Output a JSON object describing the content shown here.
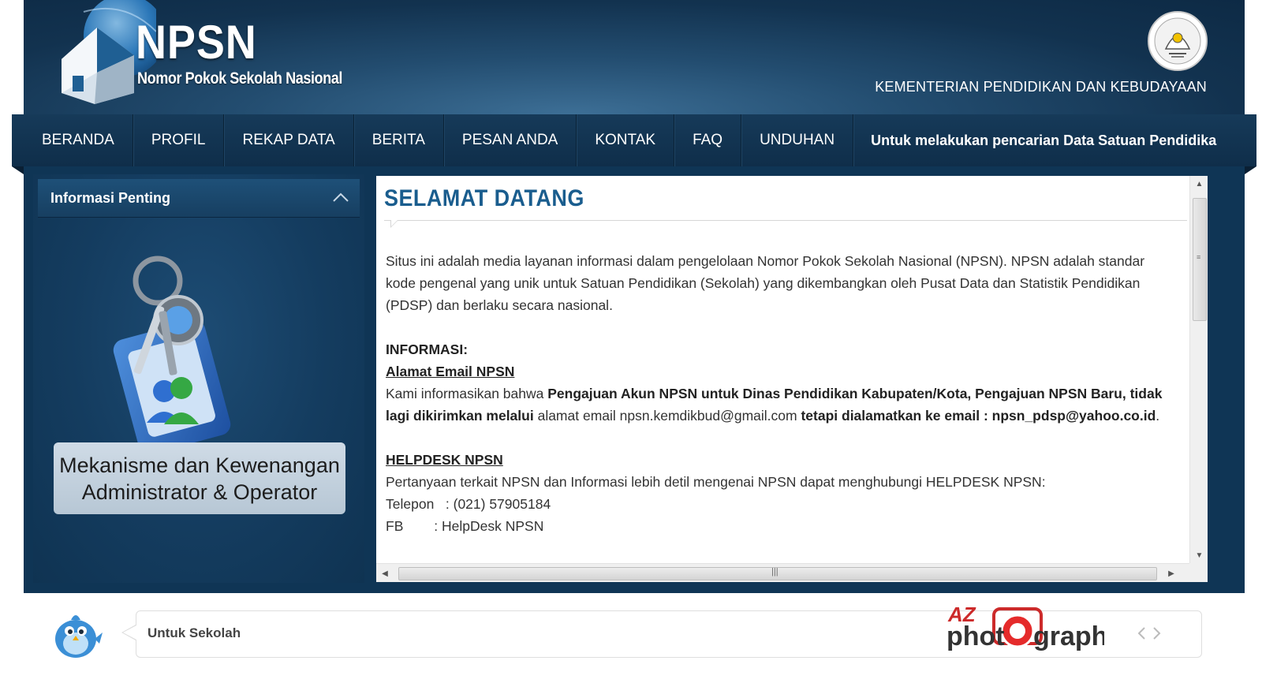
{
  "header": {
    "logo_title": "NPSN",
    "logo_subtitle": "Nomor Pokok Sekolah Nasional",
    "ministry": "KEMENTERIAN PENDIDIKAN DAN KEBUDAYAAN"
  },
  "nav": {
    "items": [
      {
        "label": "BERANDA"
      },
      {
        "label": "PROFIL"
      },
      {
        "label": "REKAP DATA"
      },
      {
        "label": "BERITA"
      },
      {
        "label": "PESAN ANDA"
      },
      {
        "label": "KONTAK"
      },
      {
        "label": "FAQ"
      },
      {
        "label": "UNDUHAN"
      }
    ],
    "ticker": "Untuk melakukan pencarian Data Satuan Pendidika"
  },
  "sidebar": {
    "title": "Informasi Penting",
    "banner_line1": "Mekanisme dan Kewenangan",
    "banner_line2": "Administrator & Operator"
  },
  "content": {
    "title": "SELAMAT DATANG",
    "intro": "Situs ini adalah media layanan informasi dalam pengelolaan Nomor Pokok Sekolah Nasional (NPSN). NPSN adalah standar kode pengenal yang unik untuk Satuan Pendidikan (Sekolah) yang dikembangkan oleh Pusat Data dan Statistik Pendidikan (PDSP) dan berlaku secara nasional.",
    "info_heading": "INFORMASI:",
    "email_heading": "Alamat Email NPSN",
    "email_p1": "Kami informasikan bahwa ",
    "email_b1": "Pengajuan Akun NPSN untuk Dinas Pendidikan Kabupaten/Kota, Pengajuan NPSN Baru, tidak lagi dikirimkan melalui",
    "email_p2": " alamat email npsn.kemdikbud@gmail.com ",
    "email_b2": "tetapi dialamatkan ke email : npsn_pdsp@yahoo.co.id",
    "email_end": ".",
    "helpdesk_heading": "HELPDESK NPSN",
    "helpdesk_text": "Pertanyaan terkait NPSN dan Informasi lebih detil mengenai NPSN dapat menghubungi HELPDESK NPSN:",
    "phone_line": "Telepon   : (021) 57905184",
    "fb_line": "FB        : HelpDesk NPSN"
  },
  "footer": {
    "ticker_label": "Untuk Sekolah",
    "watermark": "AZ photograph"
  },
  "colors": {
    "header_dark": "#0d2a45",
    "nav": "#133654",
    "title_blue": "#1a5d8e"
  }
}
